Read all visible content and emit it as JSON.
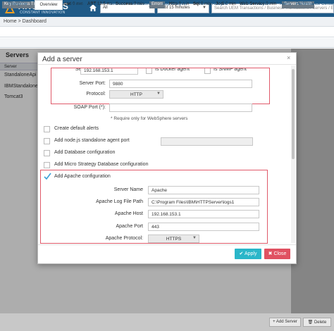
{
  "brand": {
    "name": "ARCTURUS",
    "tagline": "CONSTANT INNOVATION"
  },
  "topbar": {
    "filter_select": "All",
    "time_select": "Last 15 minutes",
    "search_placeholder": "Search UEM Transactions / Business Transactions / Servers / Enterprise"
  },
  "breadcrumb": "Home > Dashboard",
  "stats": {
    "chip_health": "Key Business Txn Health",
    "items": [
      {
        "label": "Load",
        "value": "0 min"
      },
      {
        "label": "ART",
        "value": "12.5 ms"
      },
      {
        "label": "Success",
        "value": "0 min"
      }
    ],
    "chip_errors": "Errors",
    "items2": [
      {
        "label": "Http",
        "value": "0 min"
      },
      {
        "label": "Sql",
        "value": "0 min"
      },
      {
        "label": "Jodi",
        "value": "0 min"
      },
      {
        "label": "Web Service",
        "value": "0 min"
      }
    ],
    "chip_servers": "Servers Health"
  },
  "nav_tabs": [
    "Enterprise",
    "Overview",
    "User Experience",
    "Business Transactions",
    "App Analyzer",
    "Server Analyzer",
    "Sensor Analyzer",
    "Alerts",
    "Performance Center"
  ],
  "servers_panel": {
    "title": "Servers",
    "column": "Server",
    "rows": [
      "StandaloneApi",
      "IBMStandalone",
      "Tomcat3"
    ]
  },
  "bottom_buttons": {
    "add_server": "+ Add Server",
    "delete": "Delete"
  },
  "modal": {
    "title": "Add a server",
    "close_glyph": "×",
    "server_ip_label": "Server IP:",
    "server_ip_value": "192.168.153.1",
    "is_docker_label": "Is Docker agent",
    "is_snmp_label": "Is SNMP agent",
    "server_port_label": "Server Port:",
    "server_port_value": "9880",
    "protocol_label": "Protocol:",
    "protocol_value": "HTTP",
    "soap_port_label": "SOAP Port (*):",
    "soap_port_value": "",
    "soap_note": "* Require only for WebSphere servers",
    "checkboxes": [
      {
        "label": "Create default alerts",
        "checked": false
      },
      {
        "label": "Add node.js standalone agent port",
        "checked": false
      },
      {
        "label": "Add Database configuration",
        "checked": false
      },
      {
        "label": "Add Micro Strategy Database configuration",
        "checked": false
      }
    ],
    "apache": {
      "checkbox_label": "Add Apache configuration",
      "checked": true,
      "server_name_label": "Server Name",
      "server_name_value": "Apache",
      "log_path_label": "Apache Log File Path",
      "log_path_value": "C:\\Program Files\\IBM\\HTTPServer\\logs1",
      "host_label": "Apache Host",
      "host_value": "192.168.153.1",
      "port_label": "Apache Port",
      "port_value": "443",
      "protocol_label": "Apache Protocol:",
      "protocol_value": "HTTPS"
    },
    "apply_label": "Apply",
    "close_label": "Close"
  },
  "colors": {
    "topbar": "#1f5a87",
    "apply": "#2ab6c9",
    "close": "#e05161",
    "highlight": "#e05a6a"
  }
}
